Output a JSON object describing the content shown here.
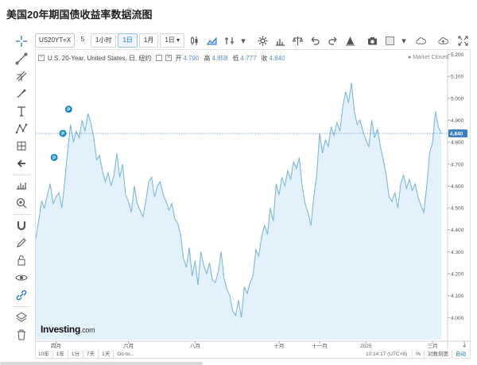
{
  "page": {
    "title": "美国20年期国债收益率数据流图"
  },
  "toolbar": {
    "symbol": "US20YT=X",
    "interval_input": "5",
    "btn_1h": "1小时",
    "btn_1d": "1日",
    "btn_1m": "1月",
    "btn_period": "1日"
  },
  "legend": {
    "name": "U.S. 20-Year, United States, 日, 纽约",
    "open_label": "开",
    "open": "4.790",
    "high_label": "高",
    "high": "4.858",
    "low_label": "低",
    "low": "4.777",
    "close_label": "收",
    "close": "4.840",
    "market_status": "Market Closed"
  },
  "logo": {
    "text": "Investing",
    "suffix": ".com"
  },
  "range_bar": {
    "buttons": [
      "10年",
      "1年",
      "1分",
      "7天",
      "1天",
      "Go to..."
    ],
    "time": "10:14:17 (UTC+8)",
    "percent": "%",
    "log": "对数刻度",
    "auto": "自动"
  },
  "colors": {
    "line": "#7fb7dd",
    "area": "#e3f1fa",
    "last_price_badge": "#3b7fc4",
    "event_marker": "#1e88c9"
  },
  "icons": {
    "left_toolbar": [
      "crosshair-icon",
      "trend-line-icon",
      "fib-icon",
      "brush-icon",
      "text-icon",
      "pattern-icon",
      "forecast-icon",
      "back-arrow-icon",
      "measure-icon",
      "zoom-in-icon",
      "magnet-icon",
      "pencil-icon",
      "lock-icon",
      "eye-icon",
      "link-icon",
      "layers-icon",
      "trash-icon"
    ],
    "top_toolbar": [
      "candle-icon",
      "area-chart-icon",
      "indicator-icon",
      "settings-icon",
      "compare-icon",
      "scale-icon",
      "undo-icon",
      "redo-icon",
      "alert-icon",
      "camera-icon",
      "template-icon",
      "cloud-icon",
      "cloud-upload-icon",
      "fullscreen-icon"
    ]
  },
  "chart_data": {
    "type": "area",
    "title": "",
    "xlabel": "",
    "ylabel": "",
    "ylim": [
      3.9,
      5.22
    ],
    "y_ticks": [
      "5.200",
      "5.100",
      "5.000",
      "4.900",
      "4.800",
      "4.700",
      "4.600",
      "4.500",
      "4.400",
      "4.300",
      "4.200",
      "4.100",
      "4.000"
    ],
    "y_tick_values": [
      5.2,
      5.1,
      5.0,
      4.9,
      4.8,
      4.7,
      4.6,
      4.5,
      4.4,
      4.3,
      4.2,
      4.1,
      4.0
    ],
    "x_tick_labels": [
      {
        "label": "四月",
        "index": 7
      },
      {
        "label": "六月",
        "index": 32
      },
      {
        "label": "八月",
        "index": 55
      },
      {
        "label": "十月",
        "index": 84
      },
      {
        "label": "十一月",
        "index": 98
      },
      {
        "label": "2025",
        "index": 114
      },
      {
        "label": "三月",
        "index": 137
      },
      {
        "label": "4",
        "index": 148
      }
    ],
    "last_value": 4.84,
    "last_value_label": "4.840",
    "grid": false,
    "events": [
      {
        "index": 13,
        "value": 4.95,
        "label": "P"
      },
      {
        "index": 11,
        "value": 4.84,
        "label": "P"
      },
      {
        "index": 8,
        "value": 4.73,
        "label": "P"
      }
    ],
    "series": [
      {
        "values": [
          4.36,
          4.44,
          4.53,
          4.5,
          4.56,
          4.61,
          4.52,
          4.55,
          4.57,
          4.5,
          4.62,
          4.76,
          4.88,
          4.8,
          4.85,
          4.82,
          4.9,
          4.85,
          4.93,
          4.89,
          4.82,
          4.72,
          4.74,
          4.67,
          4.62,
          4.66,
          4.6,
          4.65,
          4.75,
          4.64,
          4.7,
          4.56,
          4.53,
          4.48,
          4.6,
          4.52,
          4.49,
          4.46,
          4.53,
          4.62,
          4.64,
          4.55,
          4.6,
          4.62,
          4.56,
          4.53,
          4.49,
          4.52,
          4.45,
          4.43,
          4.38,
          4.27,
          4.23,
          4.32,
          4.19,
          4.26,
          4.15,
          4.3,
          4.24,
          4.2,
          4.25,
          4.17,
          4.16,
          4.21,
          4.3,
          4.18,
          4.13,
          4.1,
          4.03,
          4.01,
          4.08,
          4.0,
          4.14,
          4.11,
          4.16,
          4.19,
          4.31,
          4.28,
          4.37,
          4.42,
          4.38,
          4.5,
          4.44,
          4.61,
          4.56,
          4.64,
          4.6,
          4.67,
          4.63,
          4.71,
          4.68,
          4.73,
          4.6,
          4.52,
          4.48,
          4.42,
          4.55,
          4.65,
          4.84,
          4.75,
          4.81,
          4.78,
          4.87,
          4.83,
          4.89,
          4.85,
          4.96,
          5.03,
          4.98,
          5.07,
          4.94,
          4.88,
          4.9,
          4.85,
          4.81,
          4.78,
          4.9,
          4.82,
          4.86,
          4.78,
          4.72,
          4.65,
          4.55,
          4.53,
          4.57,
          4.5,
          4.61,
          4.65,
          4.59,
          4.63,
          4.58,
          4.61,
          4.55,
          4.51,
          4.48,
          4.6,
          4.75,
          4.8,
          4.94,
          4.87,
          4.84
        ]
      }
    ]
  }
}
